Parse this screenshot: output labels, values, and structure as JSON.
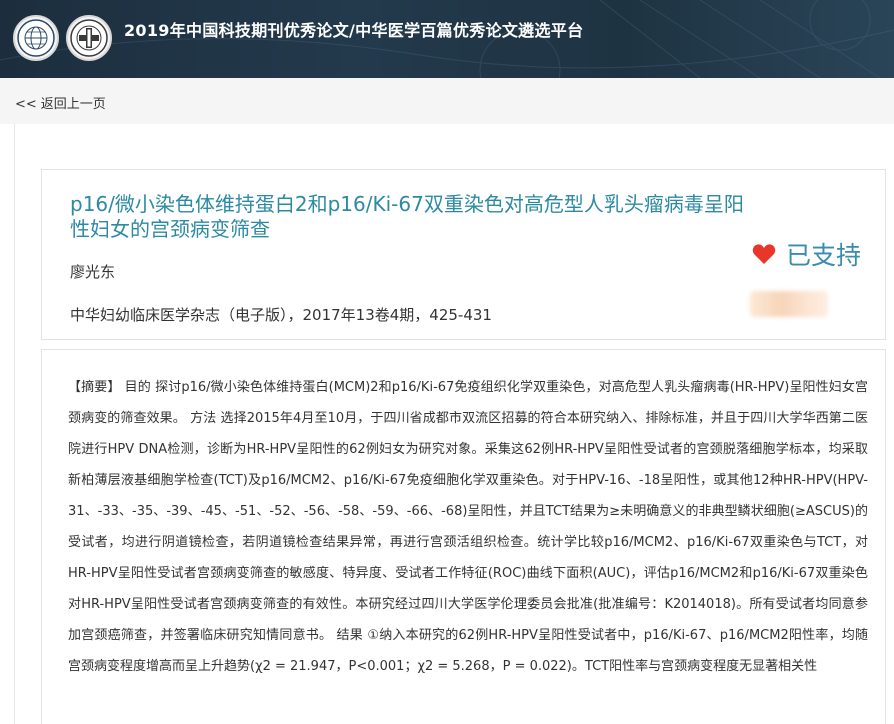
{
  "header": {
    "title": "2019年中国科技期刊优秀论文/中华医学百篇优秀论文遴选平台",
    "logo1_icon": "globe-emblem-icon",
    "logo2_icon": "medical-association-emblem-icon"
  },
  "nav": {
    "back_chevrons": "<<",
    "back_label": "返回上一页"
  },
  "paper": {
    "title": "p16/微小染色体维持蛋白2和p16/Ki-67双重染色对高危型人乳头瘤病毒呈阳性妇女的宫颈病变筛查",
    "author": "廖光东",
    "journal": "中华妇幼临床医学杂志（电子版），2017年13卷4期，425-431",
    "support_label": "已支持",
    "support_icon": "heart-icon",
    "support_color": "#e8362b",
    "title_color": "#2d8aa3"
  },
  "abstract": {
    "label": "【摘要】",
    "text": " 目的 探讨p16/微小染色体维持蛋白(MCM)2和p16/Ki-67免疫组织化学双重染色，对高危型人乳头瘤病毒(HR-HPV)呈阳性妇女宫颈病变的筛查效果。 方法 选择2015年4月至10月，于四川省成都市双流区招募的符合本研究纳入、排除标准，并且于四川大学华西第二医院进行HPV DNA检测，诊断为HR-HPV呈阳性的62例妇女为研究对象。采集这62例HR-HPV呈阳性受试者的宫颈脱落细胞学标本，均采取新柏薄层液基细胞学检查(TCT)及p16/MCM2、p16/Ki-67免疫细胞化学双重染色。对于HPV-16、-18呈阳性，或其他12种HR-HPV(HPV-31、-33、-35、-39、-45、-51、-52、-56、-58、-59、-66、-68)呈阳性，并且TCT结果为≥未明确意义的非典型鳞状细胞(≥ASCUS)的受试者，均进行阴道镜检查，若阴道镜检查结果异常，再进行宫颈活组织检查。统计学比较p16/MCM2、p16/Ki-67双重染色与TCT，对HR-HPV呈阳性受试者宫颈病变筛查的敏感度、特异度、受试者工作特征(ROC)曲线下面积(AUC)，评估p16/MCM2和p16/Ki-67双重染色对HR-HPV呈阳性受试者宫颈病变筛查的有效性。本研究经过四川大学医学伦理委员会批准(批准编号：K2014018)。所有受试者均同意参加宫颈癌筛查，并签署临床研究知情同意书。 结果 ①纳入本研究的62例HR-HPV呈阳性受试者中，p16/Ki-67、p16/MCM2阳性率，均随宫颈病变程度增高而呈上升趋势(χ2 = 21.947，P<0.001；χ2 = 5.268，P = 0.022)。TCT阳性率与宫颈病变程度无显著相关性"
  }
}
